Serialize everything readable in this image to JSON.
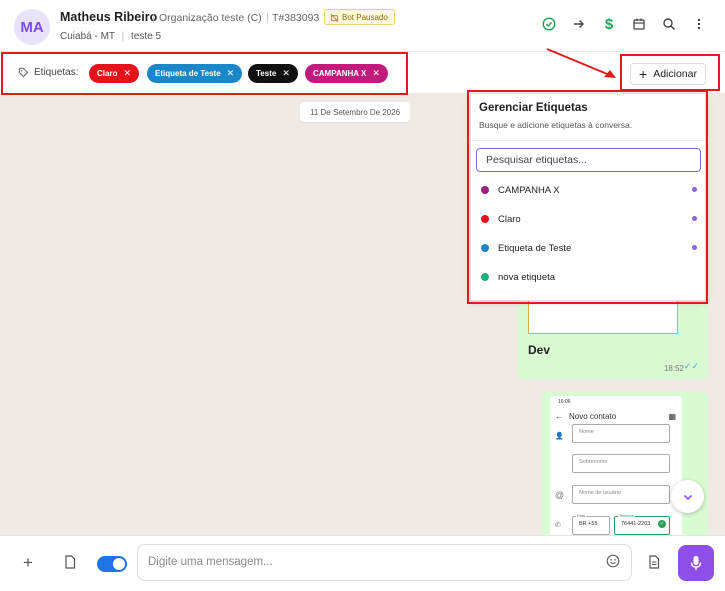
{
  "header": {
    "avatar_initials": "MA",
    "contact_name": "Matheus Ribeiro",
    "organization": "Organização teste (C)",
    "ticket": "T#383093",
    "bot_status": "Bot Pausado",
    "location": "Cuiabá - MT",
    "queue": "teste 5",
    "icons": [
      "check-circle-icon",
      "arrow-right-icon",
      "dollar-icon",
      "calendar-icon",
      "search-icon",
      "more-vertical-icon"
    ]
  },
  "tags": {
    "label": "Etiquetas:",
    "chips": [
      {
        "label": "Claro",
        "color": "#e5121b"
      },
      {
        "label": "Etiqueta de Teste",
        "color": "#1b87c9"
      },
      {
        "label": "Teste",
        "color": "#111111"
      },
      {
        "label": "CAMPANHA X",
        "color": "#c01b7c"
      }
    ],
    "add_label": "Adicionar"
  },
  "chat": {
    "date": "11 De Setembro De 2026",
    "message_text": "Dev",
    "message_time": "18:52",
    "phone_screen": {
      "status_time": "16:06",
      "title": "Novo contato",
      "fields": [
        "Nome",
        "Sobrenome",
        "Nome de usuário"
      ],
      "country_label": "País",
      "country_value": "BR +55",
      "phone_label": "Telefone",
      "phone_value": "76441-2203"
    }
  },
  "dropdown": {
    "title": "Gerenciar Etiquetas",
    "subtitle": "Busque e adicione etiquetas à conversa.",
    "search_placeholder": "Pesquisar etiquetas...",
    "items": [
      {
        "label": "CAMPANHA X",
        "color": "#a0207a",
        "selected": true
      },
      {
        "label": "Claro",
        "color": "#e5121b",
        "selected": true
      },
      {
        "label": "Etiqueta de Teste",
        "color": "#1b87c9",
        "selected": true
      },
      {
        "label": "nova etiqueta",
        "color": "#19b37a",
        "selected": false
      }
    ]
  },
  "composer": {
    "placeholder": "Digite uma mensagem..."
  },
  "colors": {
    "accent": "#8d4fe8",
    "highlight": "#e21a1a",
    "chat_bg": "#efeae3",
    "bubble": "#d8fbd2"
  }
}
